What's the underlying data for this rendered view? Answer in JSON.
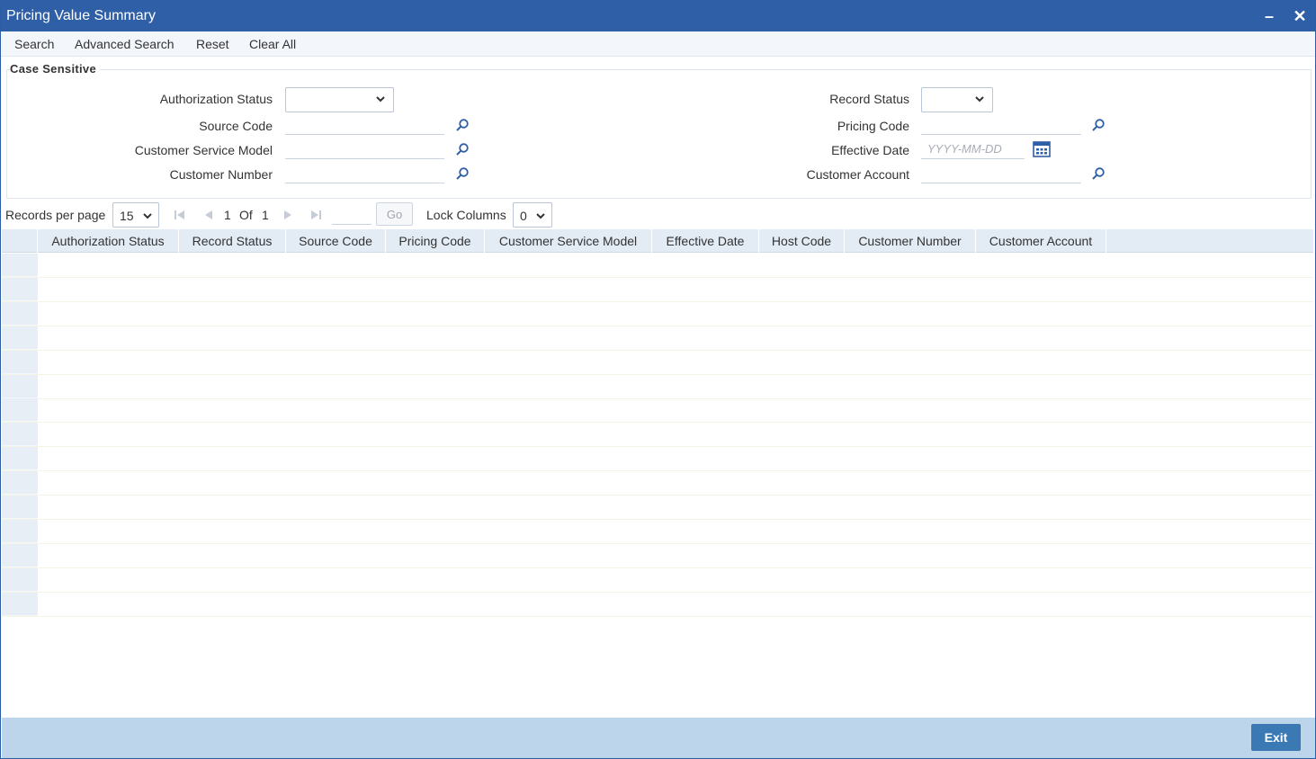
{
  "window": {
    "title": "Pricing Value Summary",
    "minimize": "–",
    "close": "✕"
  },
  "menu": [
    "Search",
    "Advanced Search",
    "Reset",
    "Clear All"
  ],
  "criteria": {
    "legend": "Case Sensitive",
    "authorization_status_label": "Authorization Status",
    "source_code_label": "Source Code",
    "customer_service_model_label": "Customer Service Model",
    "customer_number_label": "Customer Number",
    "record_status_label": "Record Status",
    "pricing_code_label": "Pricing Code",
    "effective_date_label": "Effective Date",
    "effective_date_placeholder": "YYYY-MM-DD",
    "customer_account_label": "Customer Account"
  },
  "pager": {
    "records_per_page_label": "Records per page",
    "records_per_page_value": "15",
    "current_page": "1",
    "of_label": "Of",
    "total_pages": "1",
    "go_label": "Go",
    "lock_columns_label": "Lock Columns",
    "lock_columns_value": "0"
  },
  "table": {
    "columns": [
      "Authorization Status",
      "Record Status",
      "Source Code",
      "Pricing Code",
      "Customer Service Model",
      "Effective Date",
      "Host Code",
      "Customer Number",
      "Customer Account"
    ],
    "row_count": 15
  },
  "footer": {
    "exit_label": "Exit"
  },
  "colors": {
    "titlebar": "#2f5fa6",
    "icon_blue": "#2f5fa6",
    "footer": "#bdd5eb",
    "exit_button": "#3a79b3"
  },
  "icons": {
    "lookup": "magnifier-icon",
    "calendar": "calendar-icon",
    "dropdown": "chevron-down-icon"
  }
}
